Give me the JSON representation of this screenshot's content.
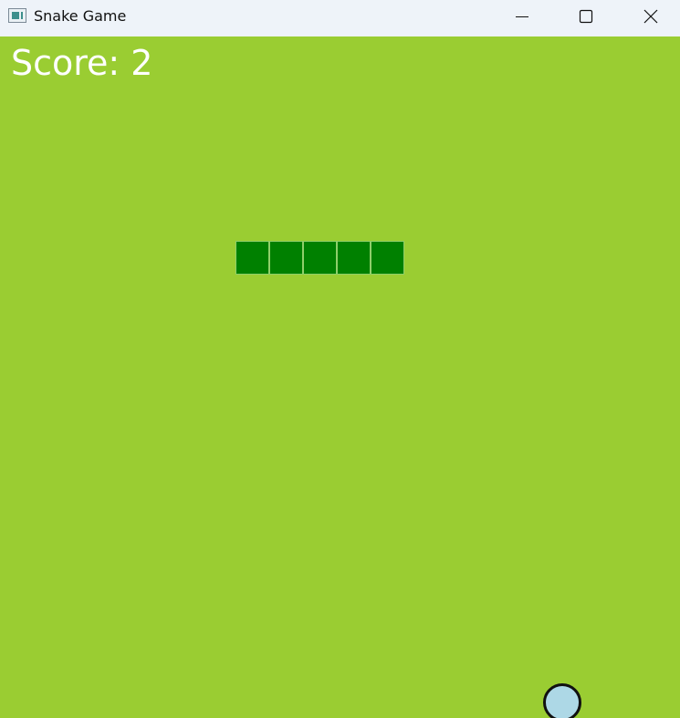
{
  "window": {
    "title": "Snake Game",
    "icon": "window-app-icon",
    "controls": {
      "minimize_icon": "minimize-icon",
      "maximize_icon": "maximize-icon",
      "close_icon": "close-icon"
    }
  },
  "game": {
    "score_text": "Score: 2",
    "score_value": 2,
    "background_color": "#9acd32",
    "snake": {
      "color": "#008000",
      "segments": 5,
      "direction": "horizontal"
    },
    "food": {
      "shape": "circle",
      "color": "#add8e6"
    }
  }
}
